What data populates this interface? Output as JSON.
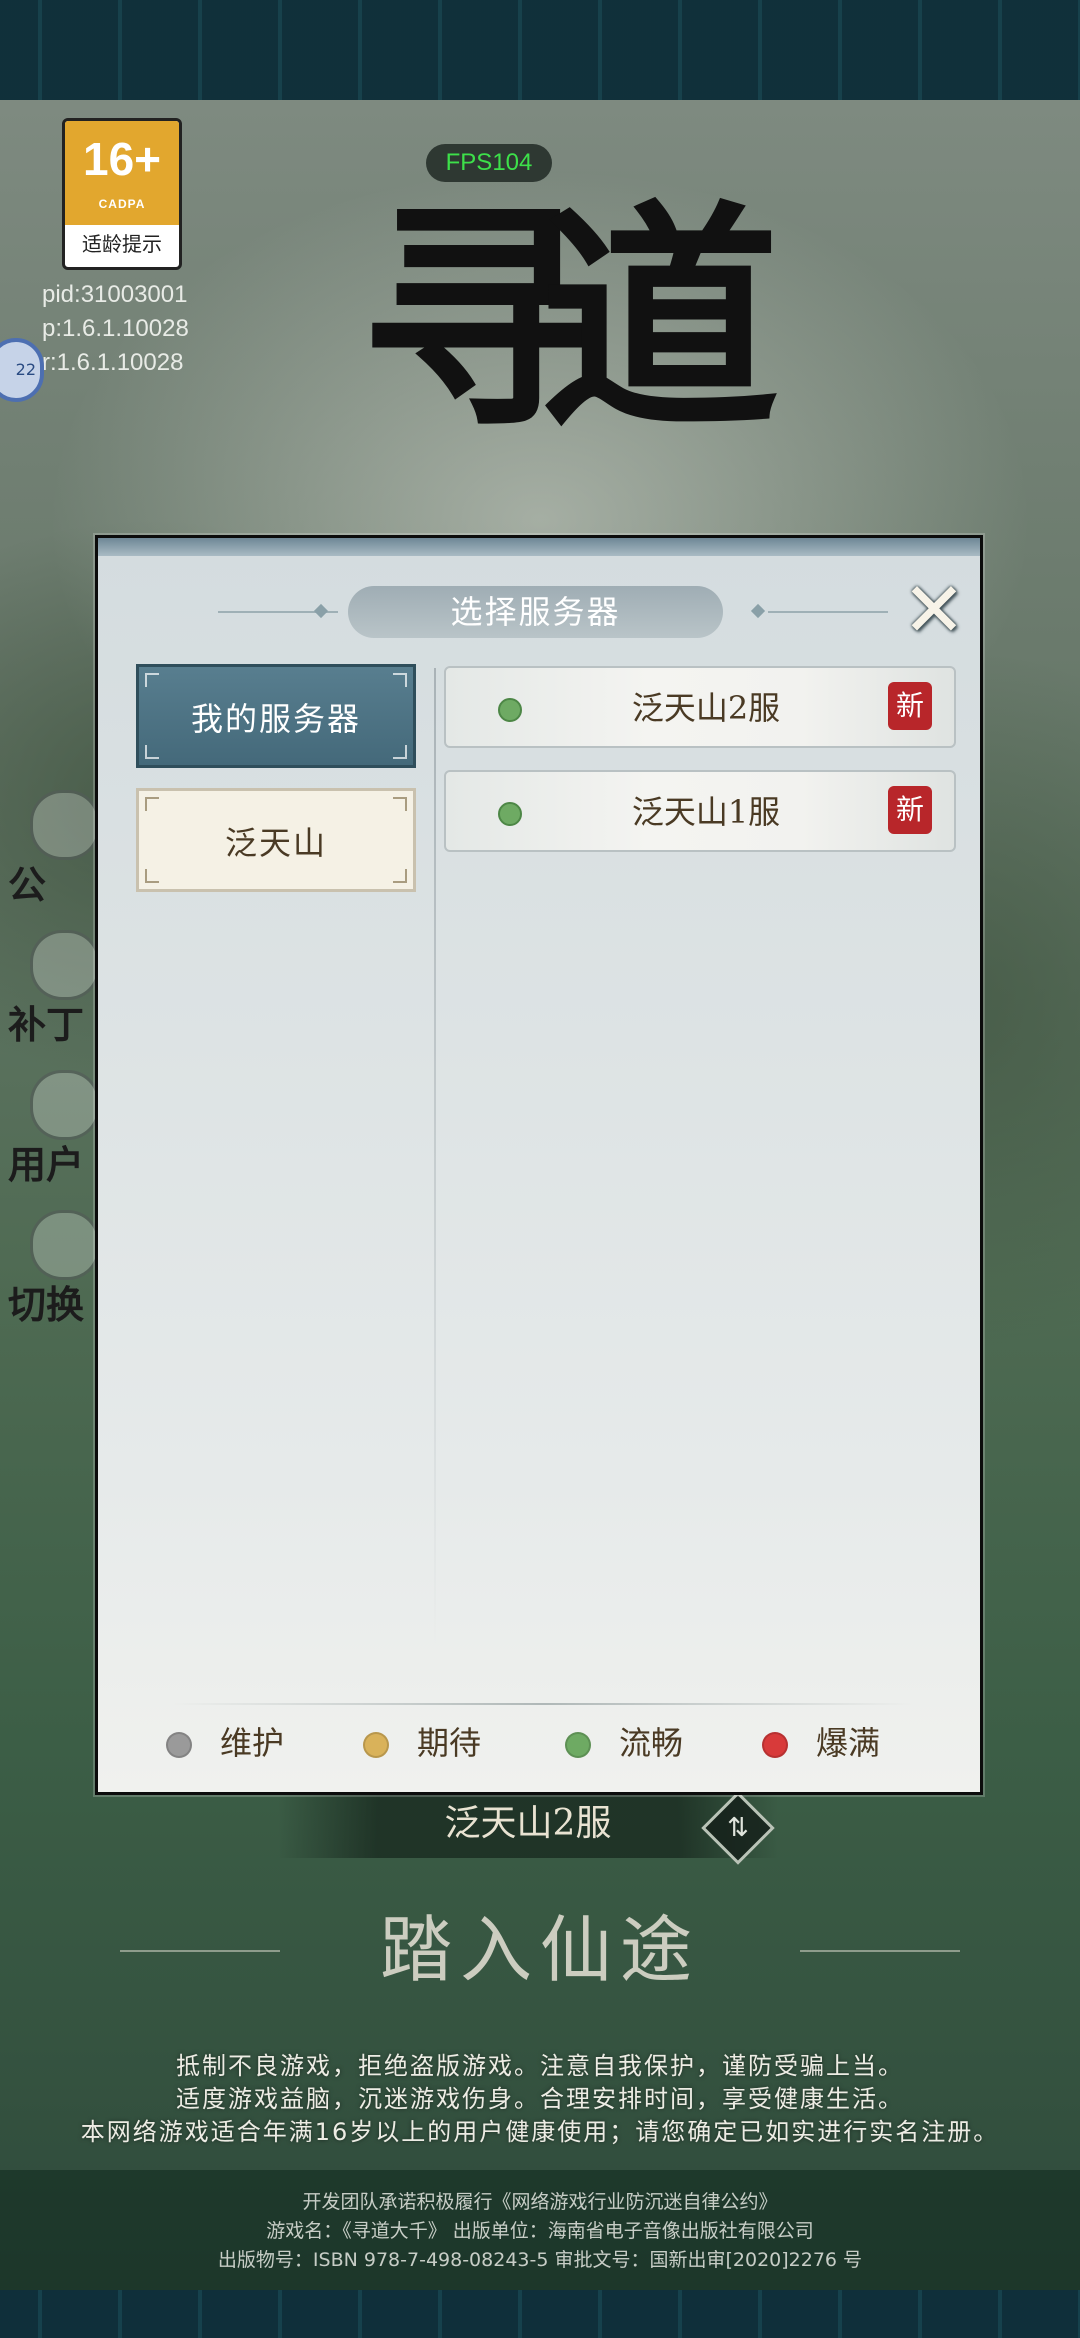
{
  "background": {
    "age_rating": {
      "age": "16+",
      "org": "CADPA",
      "tip": "适龄提示"
    },
    "fps": "FPS104",
    "build_info": [
      "pid:31003001",
      "p:1.6.1.10028",
      "r:1.6.1.10028"
    ],
    "edge_badge": "22",
    "logo_text": "寻道",
    "side_menu": [
      "公",
      "补丁",
      "用户",
      "切换"
    ],
    "current_server": "泛天山2服",
    "start_button": "踏入仙途",
    "notice_lines": [
      "抵制不良游戏，拒绝盗版游戏。注意自我保护，谨防受骗上当。",
      "适度游戏益脑，沉迷游戏伤身。合理安排时间，享受健康生活。",
      "本网络游戏适合年满16岁以上的用户健康使用；请您确定已如实进行实名注册。"
    ],
    "footer_lines": [
      "开发团队承诺积极履行《网络游戏行业防沉迷自律公约》",
      "游戏名：《寻道大千》 出版单位：海南省电子音像出版社有限公司",
      "出版物号：ISBN 978-7-498-08243-5 审批文号：国新出审[2020]2276 号"
    ]
  },
  "modal": {
    "title": "选择服务器",
    "close_icon": "close-brush-x",
    "tabs": [
      {
        "label": "我的服务器",
        "active": true
      },
      {
        "label": "泛天山",
        "active": false
      }
    ],
    "servers": [
      {
        "name": "泛天山2服",
        "status": "流畅",
        "badge": "新"
      },
      {
        "name": "泛天山1服",
        "status": "流畅",
        "badge": "新"
      }
    ],
    "legend": [
      {
        "label": "维护",
        "color": "#9a9a9a"
      },
      {
        "label": "期待",
        "color": "#d9b25a"
      },
      {
        "label": "流畅",
        "color": "#6eaa63"
      },
      {
        "label": "爆满",
        "color": "#d83a3a"
      }
    ]
  }
}
